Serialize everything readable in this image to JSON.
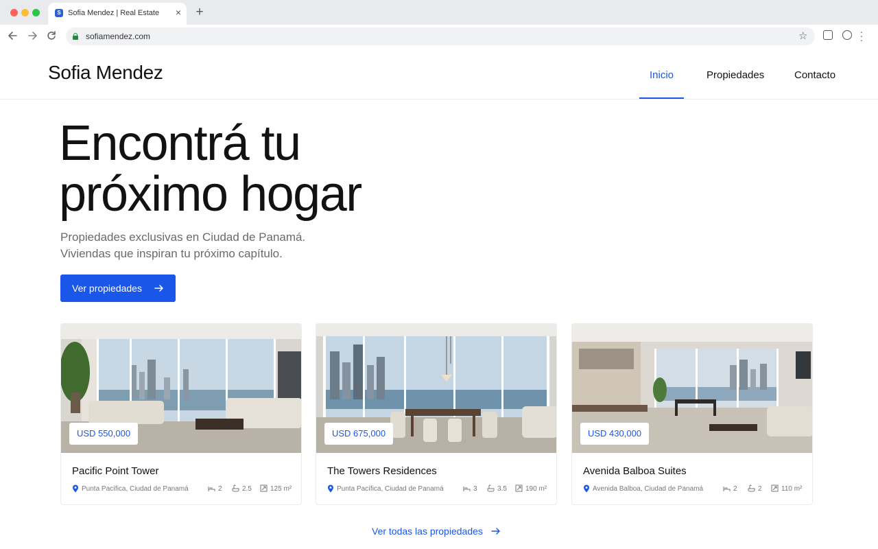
{
  "browser": {
    "tab_title": "Sofia Mendez | Real Estate",
    "favicon_letter": "S",
    "url": "sofiamendez.com",
    "new_tab": "+",
    "close": "×"
  },
  "header": {
    "brand": "Sofia Mendez",
    "nav": [
      {
        "label": "Inicio",
        "active": true
      },
      {
        "label": "Propiedades",
        "active": false
      },
      {
        "label": "Contacto",
        "active": false
      }
    ]
  },
  "hero": {
    "title": "Encontrá tu\npróximo hogar",
    "subtitle_line1": "Propiedades exclusivas en Ciudad de Panamá.",
    "subtitle_line2": "Viviendas que inspiran tu próximo capítulo.",
    "cta_label": "Ver propiedades"
  },
  "listings": [
    {
      "price": "USD 550,000",
      "name": "Pacific Point Tower",
      "location": "Punta Pacífica, Ciudad de Panamá",
      "beds": "2",
      "baths": "2.5",
      "area": "125 m²"
    },
    {
      "price": "USD 675,000",
      "name": "The Towers Residences",
      "location": "Punta Pacífica, Ciudad de Panamá",
      "beds": "3",
      "baths": "3.5",
      "area": "190 m²"
    },
    {
      "price": "USD 430,000",
      "name": "Avenida Balboa Suites",
      "location": "Avenida Balboa, Ciudad de Panamá",
      "beds": "2",
      "baths": "2",
      "area": "110 m²"
    }
  ],
  "see_all_label": "Ver todas las propiedades",
  "colors": {
    "accent": "#1a56e8"
  }
}
